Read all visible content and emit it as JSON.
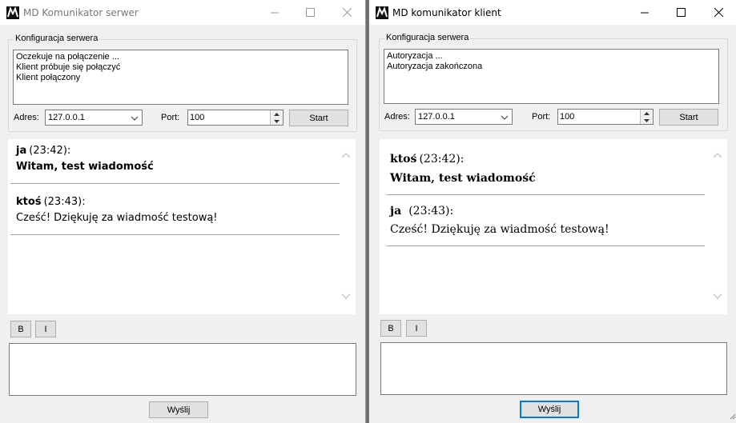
{
  "server": {
    "title": "MD Komunikator serwer",
    "group_label": "Konfiguracja serwera",
    "log": [
      "Oczekuje na połączenie ...",
      "Klient próbuje się połączyć",
      "Klient połączony"
    ],
    "address_label": "Adres:",
    "address_value": "127.0.0.1",
    "port_label": "Port:",
    "port_value": "100",
    "start_label": "Start",
    "messages": [
      {
        "name": "ja",
        "time": "(23:42):",
        "text": "Witam, test wiadomość"
      },
      {
        "name": "ktoś",
        "time": "(23:43):",
        "text": "Cześć! Dziękuję za wiadmość testową!"
      }
    ],
    "bold_label": "B",
    "italic_label": "I",
    "send_label": "Wyślij"
  },
  "client": {
    "title": "MD komunikator klient",
    "group_label": "Konfiguracja serwera",
    "log": [
      "Autoryzacja ...",
      "Autoryzacja zakończona"
    ],
    "address_label": "Adres:",
    "address_value": "127.0.0.1",
    "port_label": "Port:",
    "port_value": "100",
    "start_label": "Start",
    "messages": [
      {
        "name": "ktoś",
        "time": "(23:42):",
        "text": "Witam, test wiadomość"
      },
      {
        "name": "ja",
        "time": "(23:43):",
        "text": "Cześć! Dziękuję za wiadmość testową!"
      }
    ],
    "bold_label": "B",
    "italic_label": "I",
    "send_label": "Wyślij"
  },
  "icons": {
    "app": "md-logo-icon",
    "minimize": "minimize-icon",
    "maximize": "maximize-icon",
    "close": "close-icon",
    "dropdown": "chevron-down-icon",
    "spin_up": "spin-up-icon",
    "spin_down": "spin-down-icon",
    "scroll_up": "scroll-up-icon",
    "scroll_down": "scroll-down-icon"
  },
  "colors": {
    "focus": "#0078d7",
    "window_bg": "#f0f0f0"
  }
}
